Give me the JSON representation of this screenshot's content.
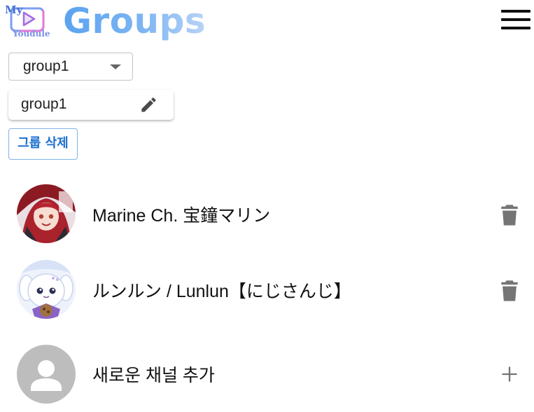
{
  "app": {
    "logo_text_top": "My",
    "logo_text_bottom": "Youdule",
    "title": "Groups"
  },
  "toolbar": {
    "menu_icon": "hamburger-menu-icon"
  },
  "group_select": {
    "selected": "group1"
  },
  "group_name_field": {
    "value": "group1",
    "edit_icon": "pencil-icon"
  },
  "delete_group_button": {
    "label": "그룹 삭제"
  },
  "channels": [
    {
      "name": "Marine Ch. 宝鐘マリン",
      "action_icon": "trash-icon"
    },
    {
      "name": "ルンルン / Lunlun【にじさんじ】",
      "action_icon": "trash-icon"
    }
  ],
  "add_channel": {
    "label": "새로운 채널 추가",
    "action_icon": "plus-icon",
    "avatar_icon": "person-icon"
  },
  "colors": {
    "title_gradient_start": "#5aa2f0",
    "button_accent": "#1a6fd0",
    "icon_gray": "#757575"
  }
}
